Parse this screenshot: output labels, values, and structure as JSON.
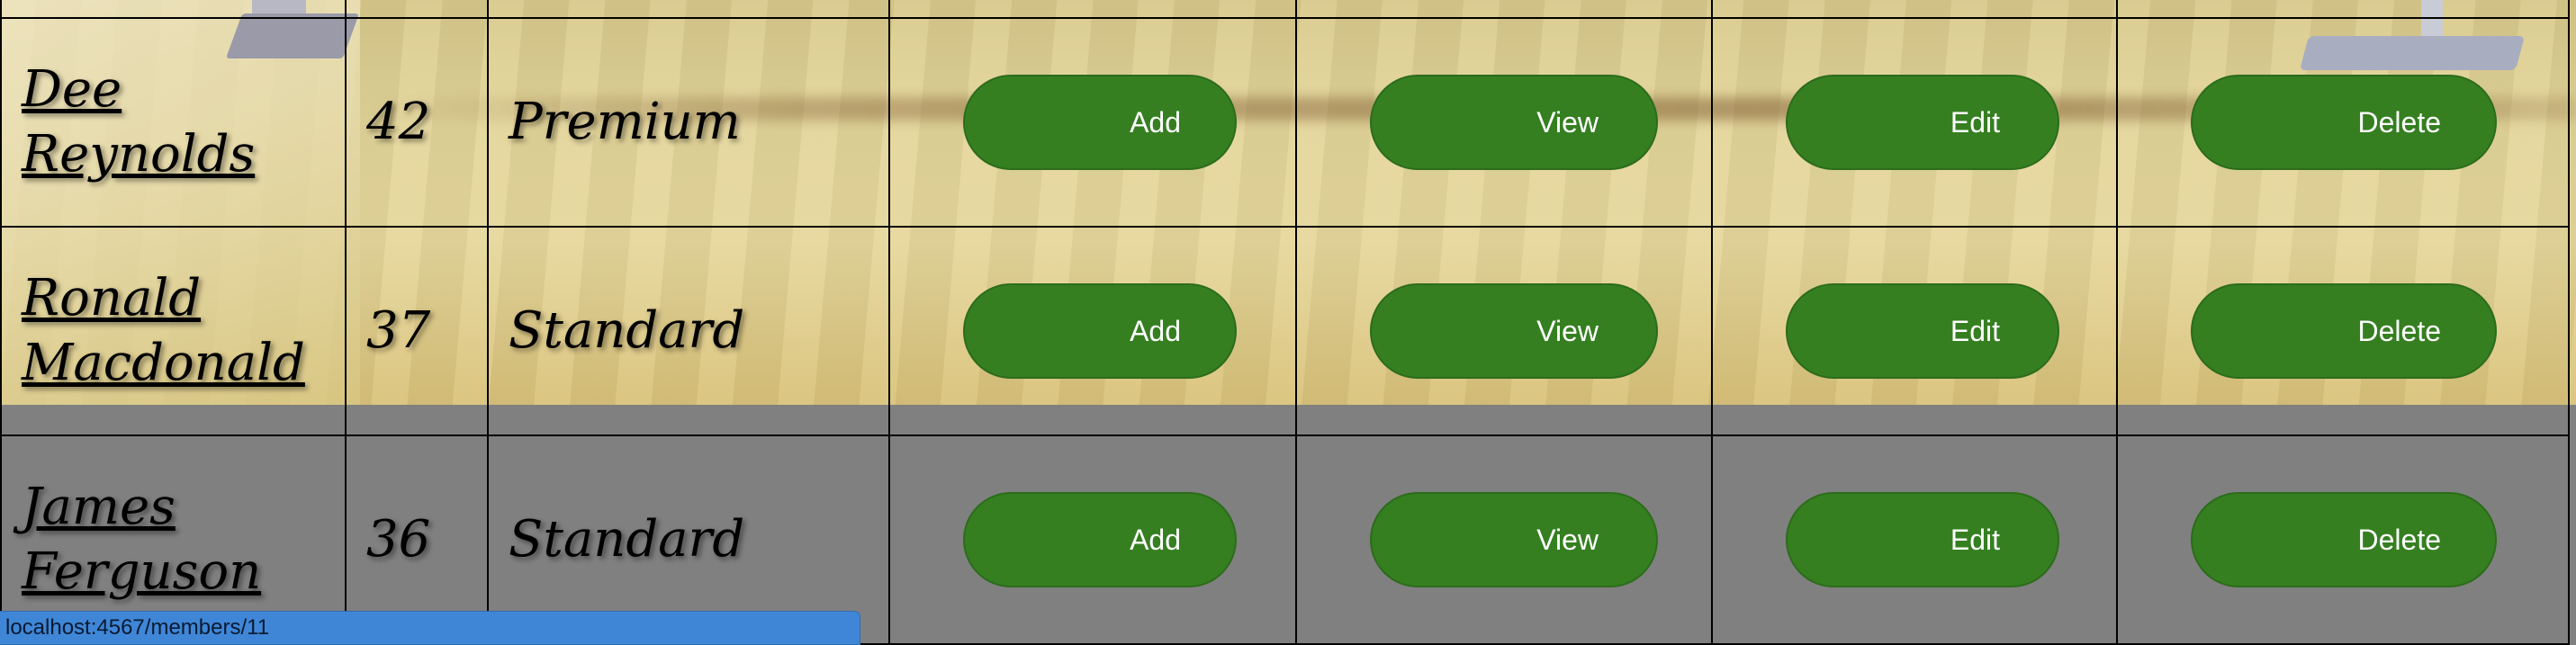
{
  "members": [
    {
      "name": "Dee Reynolds",
      "age": "42",
      "membership": "Premium"
    },
    {
      "name": "Ronald Macdonald",
      "age": "37",
      "membership": "Standard"
    },
    {
      "name": "James Ferguson",
      "age": "36",
      "membership": "Standard"
    }
  ],
  "actions": {
    "add": "Add",
    "view": "View",
    "edit": "Edit",
    "delete": "Delete"
  },
  "status_bar": {
    "url": "localhost:4567/members/11"
  },
  "colors": {
    "button": "#357f21",
    "status_bar": "#3f86d6",
    "page_bg": "#808080"
  }
}
